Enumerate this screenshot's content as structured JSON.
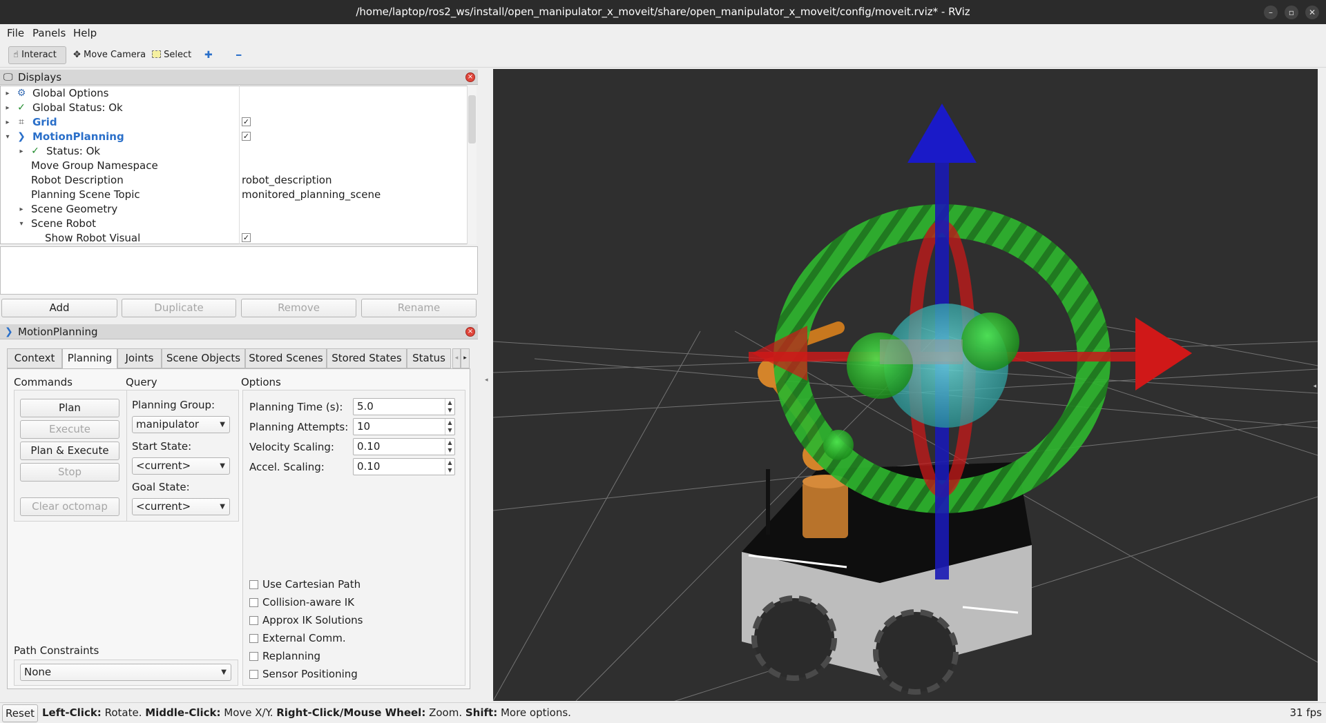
{
  "window": {
    "title": "/home/laptop/ros2_ws/install/open_manipulator_x_moveit/share/open_manipulator_x_moveit/config/moveit.rviz* - RViz",
    "minimize": "–",
    "maximize": "▫",
    "close": "✕"
  },
  "menu": {
    "file": "File",
    "panels": "Panels",
    "help": "Help"
  },
  "toolbar": {
    "interact": "Interact",
    "move_camera": "Move Camera",
    "select": "Select",
    "add_tool": "✚",
    "remove_tool": "━"
  },
  "displays": {
    "title": "Displays",
    "items": [
      {
        "label": "Global Options",
        "value": "",
        "checked": null
      },
      {
        "label": "Global Status: Ok",
        "value": "",
        "checked": null
      },
      {
        "label": "Grid",
        "value": "",
        "checked": true
      },
      {
        "label": "MotionPlanning",
        "value": "",
        "checked": true
      },
      {
        "label": "Status: Ok",
        "value": "",
        "checked": null
      },
      {
        "label": "Move Group Namespace",
        "value": "",
        "checked": null
      },
      {
        "label": "Robot Description",
        "value": "robot_description",
        "checked": null
      },
      {
        "label": "Planning Scene Topic",
        "value": "monitored_planning_scene",
        "checked": null
      },
      {
        "label": "Scene Geometry",
        "value": "",
        "checked": null
      },
      {
        "label": "Scene Robot",
        "value": "",
        "checked": null
      },
      {
        "label": "Show Robot Visual",
        "value": "",
        "checked": true
      }
    ],
    "buttons": {
      "add": "Add",
      "duplicate": "Duplicate",
      "remove": "Remove",
      "rename": "Rename"
    }
  },
  "motion_planning": {
    "title": "MotionPlanning",
    "tabs": [
      "Context",
      "Planning",
      "Joints",
      "Scene Objects",
      "Stored Scenes",
      "Stored States",
      "Status"
    ],
    "active_tab": "Planning",
    "commands": {
      "label": "Commands",
      "plan": "Plan",
      "execute": "Execute",
      "plan_execute": "Plan & Execute",
      "stop": "Stop",
      "clear_octomap": "Clear octomap"
    },
    "query": {
      "label": "Query",
      "planning_group_label": "Planning Group:",
      "planning_group": "manipulator",
      "start_state_label": "Start State:",
      "start_state": "<current>",
      "goal_state_label": "Goal State:",
      "goal_state": "<current>"
    },
    "options": {
      "label": "Options",
      "planning_time_label": "Planning Time (s):",
      "planning_time": "5.0",
      "planning_attempts_label": "Planning Attempts:",
      "planning_attempts": "10",
      "velocity_scaling_label": "Velocity Scaling:",
      "velocity_scaling": "0.10",
      "accel_scaling_label": "Accel. Scaling:",
      "accel_scaling": "0.10",
      "checkboxes": [
        "Use Cartesian Path",
        "Collision-aware IK",
        "Approx IK Solutions",
        "External Comm.",
        "Replanning",
        "Sensor Positioning"
      ]
    },
    "path_constraints": {
      "label": "Path Constraints",
      "value": "None"
    }
  },
  "statusbar": {
    "reset": "Reset",
    "hint_left_key": "Left-Click:",
    "hint_left": " Rotate. ",
    "hint_middle_key": "Middle-Click:",
    "hint_middle": " Move X/Y. ",
    "hint_right_key": "Right-Click/Mouse Wheel:",
    "hint_right": " Zoom. ",
    "hint_shift_key": "Shift:",
    "hint_shift": " More options.",
    "fps": "31 fps"
  },
  "colors": {
    "viewport_bg": "#2f2f2f",
    "accent_blue": "#2a6fc9",
    "ring_green": "#2aa12a",
    "axis_red": "#d01818",
    "axis_blue": "#1515c8",
    "robot_orange": "#c8781e"
  }
}
